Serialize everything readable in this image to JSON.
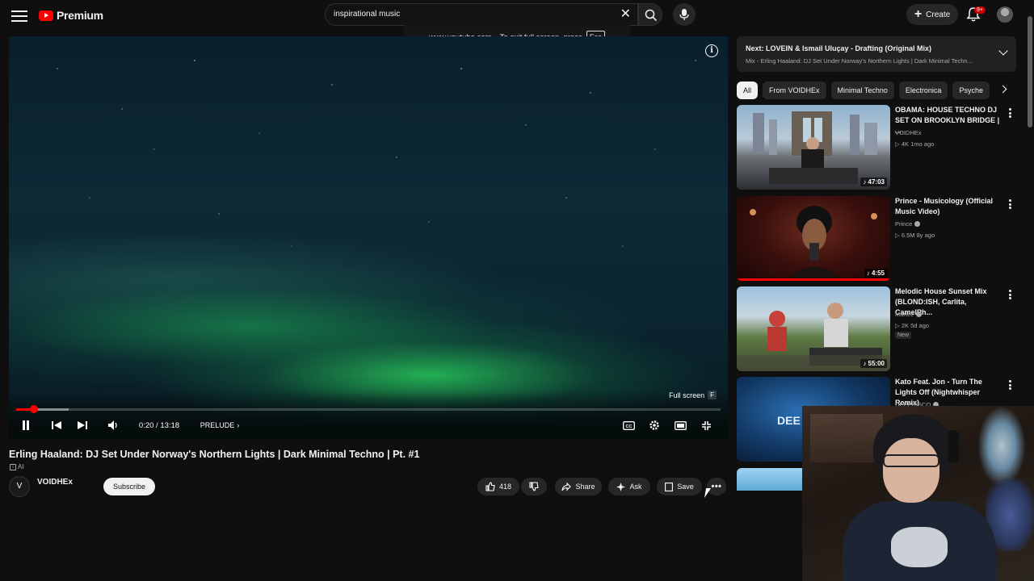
{
  "header": {
    "logo_label": "Premium",
    "search_value": "inspirational music",
    "create_label": "Create",
    "notification_badge": "9+"
  },
  "toast": {
    "message": "www.youtube.com – To exit full screen, press",
    "key": "Esc"
  },
  "player": {
    "fullscreen_tip": "Full screen",
    "fullscreen_key": "F",
    "time": "0:20 / 13:18",
    "chapter": "PRELUDE",
    "played_fraction": 0.025,
    "buffered_fraction": 0.075
  },
  "video": {
    "title": "Erling Haaland: DJ Set Under Norway's Northern Lights | Dark Minimal Techno | Pt. #1",
    "ai_tag": "AI",
    "channel_initial": "V",
    "channel": "VOIDHEx",
    "subscribe_label": "Subscribe",
    "likes": "418",
    "share_label": "Share",
    "ask_label": "Ask",
    "save_label": "Save"
  },
  "next": {
    "title": "Next: LOVEIN & Ismail Uluçay - Drafting (Original Mix)",
    "subtitle": "Mix - Erling Haaland: DJ Set Under Norway's Northern Lights | Dark Minimal Techn..."
  },
  "chips": [
    "All",
    "From VOIDHEx",
    "Minimal Techno",
    "Electronica",
    "Psyche"
  ],
  "recommendations": [
    {
      "title": "OBAMA: HOUSE TECHNO DJ SET ON BROOKLYN BRIDGE | ...",
      "channel": "VOIDHEx",
      "meta": "▷ 4K   1mo ago",
      "duration": "♪ 47:03",
      "verified": false,
      "is_new": false
    },
    {
      "title": "Prince - Musicology (Official Music Video)",
      "channel": "Prince",
      "meta": "▷ 6.5M   8y ago",
      "duration": "♪ 4:55",
      "verified": true,
      "is_new": false,
      "watched_fraction": 1.0
    },
    {
      "title": "Melodic House Sunset Mix (BLOND:ISH, Carlita, CamelPh...",
      "channel": "Martec",
      "meta": "▷ 2K   5d ago",
      "duration": "♪ 55:00",
      "verified": true,
      "is_new": true,
      "new_label": "New"
    },
    {
      "title": "Kato Feat. Jon - Turn The Lights Off (Nightwhisper Remix)",
      "channel": "DEEPDISCO",
      "meta": "",
      "duration": "",
      "verified": true,
      "is_new": false,
      "thumb_text": "DEE"
    }
  ],
  "colors": {
    "accent": "#ff0000",
    "background": "#0f0f0f",
    "surface": "#272727"
  }
}
